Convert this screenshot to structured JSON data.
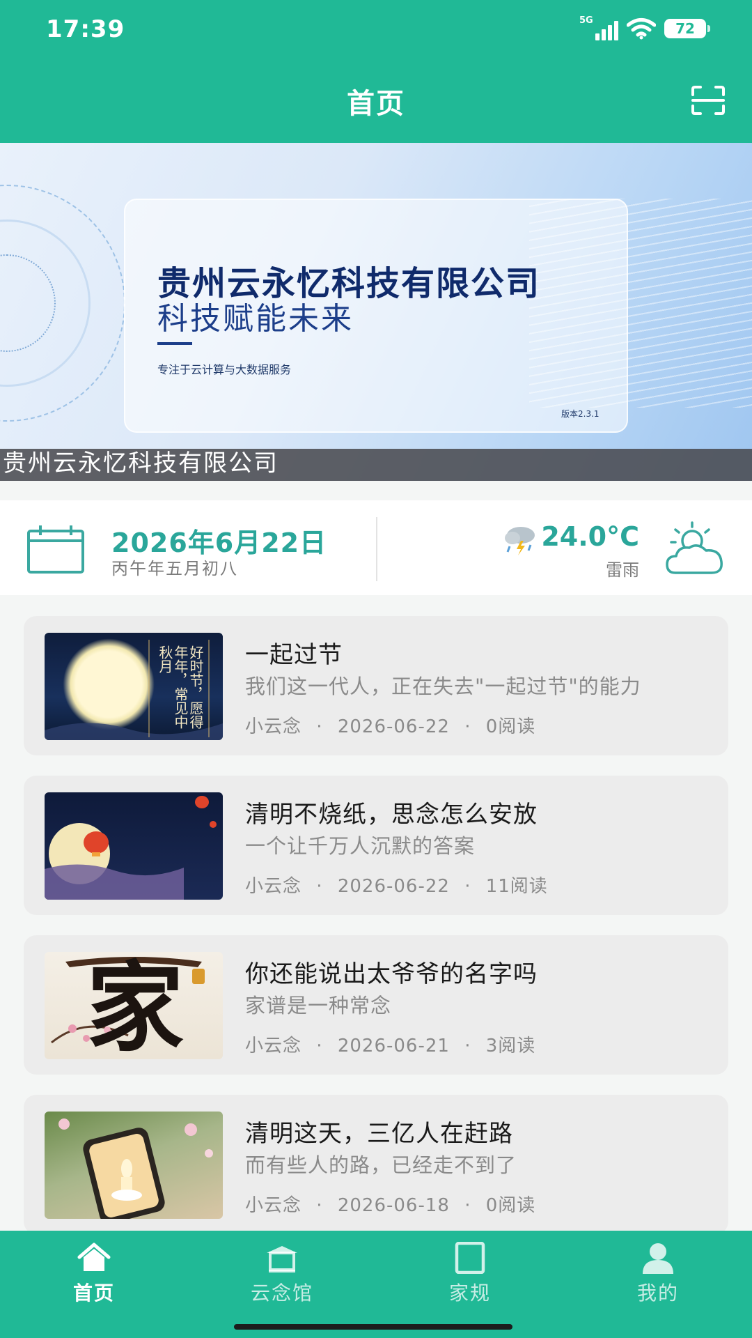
{
  "status_bar": {
    "time": "17:39",
    "network": "5G",
    "battery": "72"
  },
  "header": {
    "title": "首页",
    "scan_icon": "scan-icon"
  },
  "banner": {
    "company": "贵州云永忆科技有限公司",
    "slogan": "科技赋能未来",
    "subtitle": "专注于云计算与大数据服务",
    "version": "版本2.3.1",
    "caption": "贵州云永忆科技有限公司"
  },
  "date_weather": {
    "date": "2026年6月22日",
    "lunar": "丙午年五月初八",
    "temperature": "24.0°C",
    "condition": "雷雨",
    "icons": [
      "calendar-icon",
      "thunderstorm-icon",
      "partly-cloudy-icon"
    ]
  },
  "articles": [
    {
      "title": "一起过节",
      "summary": "我们这一代人，正在失去\"一起过节\"的能力",
      "author": "小云念",
      "date": "2026-06-22",
      "reads": "0阅读",
      "thumb_text": "好时节，愿得年年，常见中秋月"
    },
    {
      "title": "清明不烧纸，思念怎么安放",
      "summary": "一个让千万人沉默的答案",
      "author": "小云念",
      "date": "2026-06-22",
      "reads": "11阅读"
    },
    {
      "title": "你还能说出太爷爷的名字吗",
      "summary": "家谱是一种常念",
      "author": "小云念",
      "date": "2026-06-21",
      "reads": "3阅读",
      "thumb_text": "家"
    },
    {
      "title": "清明这天，三亿人在赶路",
      "summary": "而有些人的路，已经走不到了",
      "author": "小云念",
      "date": "2026-06-18",
      "reads": "0阅读"
    }
  ],
  "meta_separator": "·",
  "tabs": [
    {
      "label": "首页",
      "icon": "home-icon",
      "active": true
    },
    {
      "label": "云念馆",
      "icon": "memorial-hall-icon",
      "active": false
    },
    {
      "label": "家规",
      "icon": "square-book-icon",
      "active": false
    },
    {
      "label": "我的",
      "icon": "user-icon",
      "active": false
    }
  ],
  "colors": {
    "brand": "#20b996",
    "accent_text": "#2aa69a",
    "card_bg": "#ececec"
  }
}
